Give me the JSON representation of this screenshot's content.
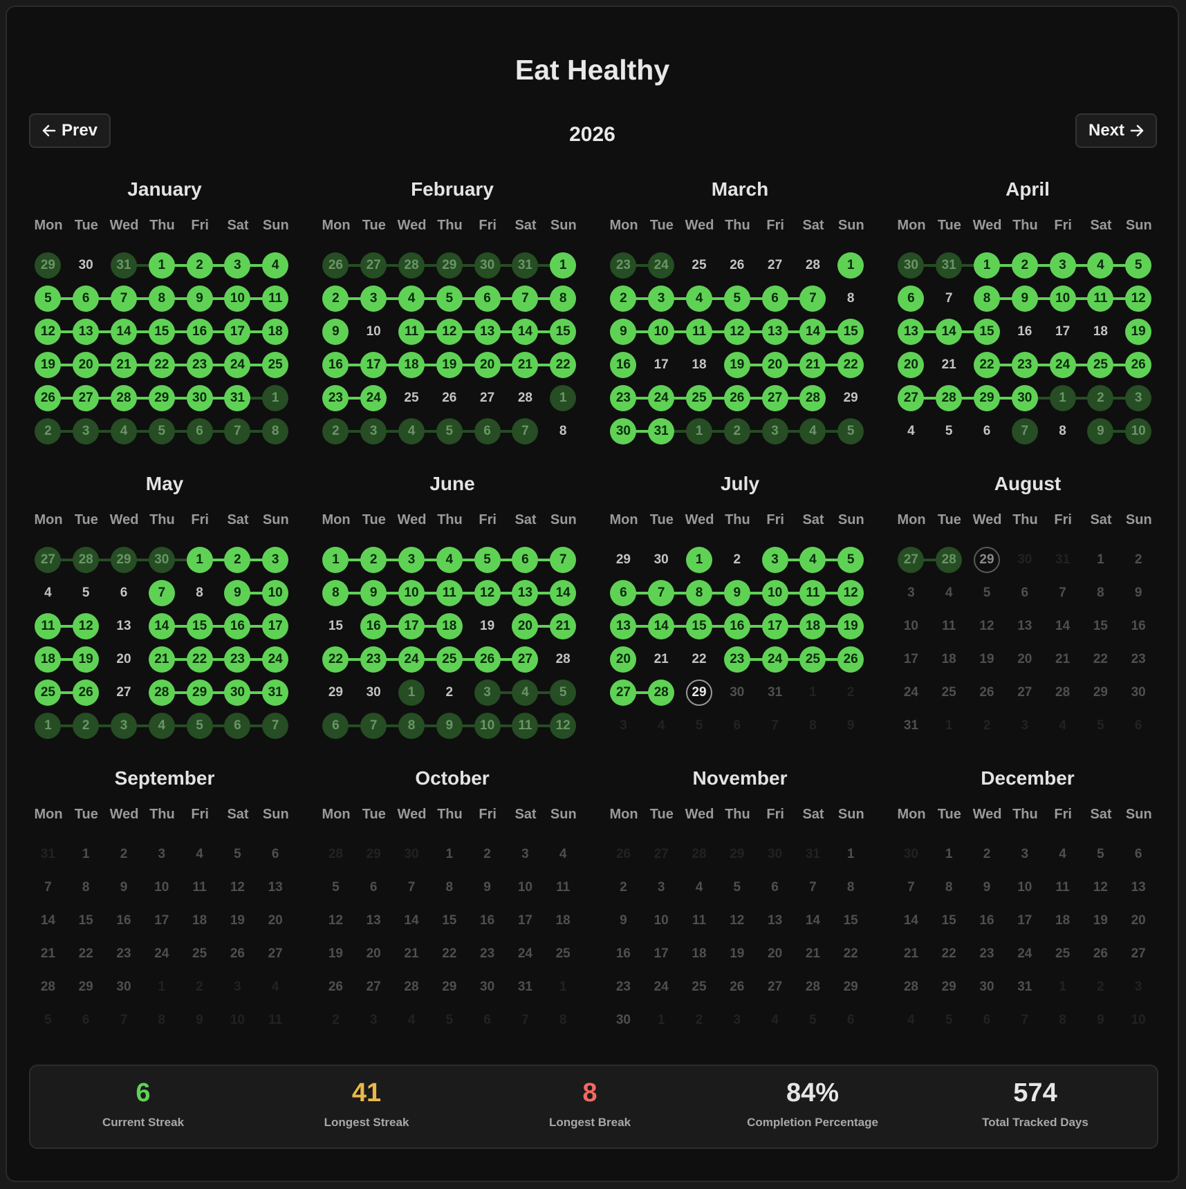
{
  "app_title": "Eat Healthy",
  "year": "2026",
  "nav": {
    "prev_label": "Prev",
    "next_label": "Next",
    "prev_icon": "arrow-left-icon",
    "next_icon": "arrow-right-icon"
  },
  "weekdays": [
    "Mon",
    "Tue",
    "Wed",
    "Thu",
    "Fri",
    "Sat",
    "Sun"
  ],
  "colors": {
    "done": "#5fd255",
    "done_faded": "#264d23",
    "current_streak": "#5fd255",
    "longest_streak": "#e8b84a",
    "longest_break": "#f06a63"
  },
  "months": [
    {
      "name": "January",
      "weeks": [
        [
          "29x",
          "30n",
          "31x",
          "1g",
          "2g",
          "3g",
          "4g"
        ],
        [
          "5g",
          "6g",
          "7g",
          "8g",
          "9g",
          "10g",
          "11g"
        ],
        [
          "12g",
          "13g",
          "14g",
          "15g",
          "16g",
          "17g",
          "18g"
        ],
        [
          "19g",
          "20g",
          "21g",
          "22g",
          "23g",
          "24g",
          "25g"
        ],
        [
          "26g",
          "27g",
          "28g",
          "29g",
          "30g",
          "31g",
          "1x"
        ],
        [
          "2x",
          "3x",
          "4x",
          "5x",
          "6x",
          "7x",
          "8x"
        ]
      ]
    },
    {
      "name": "February",
      "weeks": [
        [
          "26x",
          "27x",
          "28x",
          "29x",
          "30x",
          "31x",
          "1g"
        ],
        [
          "2g",
          "3g",
          "4g",
          "5g",
          "6g",
          "7g",
          "8g"
        ],
        [
          "9g",
          "10n",
          "11g",
          "12g",
          "13g",
          "14g",
          "15g"
        ],
        [
          "16g",
          "17g",
          "18g",
          "19g",
          "20g",
          "21g",
          "22g"
        ],
        [
          "23g",
          "24g",
          "25n",
          "26n",
          "27n",
          "28n",
          "1x"
        ],
        [
          "2x",
          "3x",
          "4x",
          "5x",
          "6x",
          "7x",
          "8n"
        ]
      ]
    },
    {
      "name": "March",
      "weeks": [
        [
          "23x",
          "24x",
          "25n",
          "26n",
          "27n",
          "28n",
          "1g"
        ],
        [
          "2g",
          "3g",
          "4g",
          "5g",
          "6g",
          "7g",
          "8n"
        ],
        [
          "9g",
          "10g",
          "11g",
          "12g",
          "13g",
          "14g",
          "15g"
        ],
        [
          "16g",
          "17n",
          "18n",
          "19g",
          "20g",
          "21g",
          "22g"
        ],
        [
          "23g",
          "24g",
          "25g",
          "26g",
          "27g",
          "28g",
          "29n"
        ],
        [
          "30g",
          "31g",
          "1x",
          "2x",
          "3x",
          "4x",
          "5x"
        ]
      ]
    },
    {
      "name": "April",
      "weeks": [
        [
          "30x",
          "31x",
          "1g",
          "2g",
          "3g",
          "4g",
          "5g"
        ],
        [
          "6g",
          "7n",
          "8g",
          "9g",
          "10g",
          "11g",
          "12g"
        ],
        [
          "13g",
          "14g",
          "15g",
          "16n",
          "17n",
          "18n",
          "19g"
        ],
        [
          "20g",
          "21n",
          "22g",
          "23g",
          "24g",
          "25g",
          "26g"
        ],
        [
          "27g",
          "28g",
          "29g",
          "30g",
          "1x",
          "2x",
          "3x"
        ],
        [
          "4n",
          "5n",
          "6n",
          "7x",
          "8n",
          "9x",
          "10x"
        ]
      ]
    },
    {
      "name": "May",
      "weeks": [
        [
          "27x",
          "28x",
          "29x",
          "30x",
          "1g",
          "2g",
          "3g"
        ],
        [
          "4n",
          "5n",
          "6n",
          "7g",
          "8n",
          "9g",
          "10g"
        ],
        [
          "11g",
          "12g",
          "13n",
          "14g",
          "15g",
          "16g",
          "17g"
        ],
        [
          "18g",
          "19g",
          "20n",
          "21g",
          "22g",
          "23g",
          "24g"
        ],
        [
          "25g",
          "26g",
          "27n",
          "28g",
          "29g",
          "30g",
          "31g"
        ],
        [
          "1x",
          "2x",
          "3x",
          "4x",
          "5x",
          "6x",
          "7x"
        ]
      ]
    },
    {
      "name": "June",
      "weeks": [
        [
          "1g",
          "2g",
          "3g",
          "4g",
          "5g",
          "6g",
          "7g"
        ],
        [
          "8g",
          "9g",
          "10g",
          "11g",
          "12g",
          "13g",
          "14g"
        ],
        [
          "15n",
          "16g",
          "17g",
          "18g",
          "19n",
          "20g",
          "21g"
        ],
        [
          "22g",
          "23g",
          "24g",
          "25g",
          "26g",
          "27g",
          "28n"
        ],
        [
          "29n",
          "30n",
          "1x",
          "2n",
          "3x",
          "4x",
          "5x"
        ],
        [
          "6x",
          "7x",
          "8x",
          "9x",
          "10x",
          "11x",
          "12x"
        ]
      ]
    },
    {
      "name": "July",
      "weeks": [
        [
          "29n",
          "30n",
          "1g",
          "2n",
          "3g",
          "4g",
          "5g"
        ],
        [
          "6g",
          "7g",
          "8g",
          "9g",
          "10g",
          "11g",
          "12g"
        ],
        [
          "13g",
          "14g",
          "15g",
          "16g",
          "17g",
          "18g",
          "19g"
        ],
        [
          "20g",
          "21n",
          "22n",
          "23g",
          "24g",
          "25g",
          "26g"
        ],
        [
          "27g",
          "28g",
          "29t",
          "30f",
          "31f",
          "1fx",
          "2fx"
        ],
        [
          "3fx",
          "4fx",
          "5fx",
          "6fx",
          "7fx",
          "8fx",
          "9fx"
        ]
      ]
    },
    {
      "name": "August",
      "weeks": [
        [
          "27x",
          "28x",
          "29t2",
          "30fx",
          "31fx",
          "1f",
          "2f"
        ],
        [
          "3f",
          "4f",
          "5f",
          "6f",
          "7f",
          "8f",
          "9f"
        ],
        [
          "10f",
          "11f",
          "12f",
          "13f",
          "14f",
          "15f",
          "16f"
        ],
        [
          "17f",
          "18f",
          "19f",
          "20f",
          "21f",
          "22f",
          "23f"
        ],
        [
          "24f",
          "25f",
          "26f",
          "27f",
          "28f",
          "29f",
          "30f"
        ],
        [
          "31f",
          "1fx",
          "2fx",
          "3fx",
          "4fx",
          "5fx",
          "6fx"
        ]
      ]
    },
    {
      "name": "September",
      "weeks": [
        [
          "31fx",
          "1f",
          "2f",
          "3f",
          "4f",
          "5f",
          "6f"
        ],
        [
          "7f",
          "8f",
          "9f",
          "10f",
          "11f",
          "12f",
          "13f"
        ],
        [
          "14f",
          "15f",
          "16f",
          "17f",
          "18f",
          "19f",
          "20f"
        ],
        [
          "21f",
          "22f",
          "23f",
          "24f",
          "25f",
          "26f",
          "27f"
        ],
        [
          "28f",
          "29f",
          "30f",
          "1fx",
          "2fx",
          "3fx",
          "4fx"
        ],
        [
          "5fx",
          "6fx",
          "7fx",
          "8fx",
          "9fx",
          "10fx",
          "11fx"
        ]
      ]
    },
    {
      "name": "October",
      "weeks": [
        [
          "28fx",
          "29fx",
          "30fx",
          "1f",
          "2f",
          "3f",
          "4f"
        ],
        [
          "5f",
          "6f",
          "7f",
          "8f",
          "9f",
          "10f",
          "11f"
        ],
        [
          "12f",
          "13f",
          "14f",
          "15f",
          "16f",
          "17f",
          "18f"
        ],
        [
          "19f",
          "20f",
          "21f",
          "22f",
          "23f",
          "24f",
          "25f"
        ],
        [
          "26f",
          "27f",
          "28f",
          "29f",
          "30f",
          "31f",
          "1fx"
        ],
        [
          "2fx",
          "3fx",
          "4fx",
          "5fx",
          "6fx",
          "7fx",
          "8fx"
        ]
      ]
    },
    {
      "name": "November",
      "weeks": [
        [
          "26fx",
          "27fx",
          "28fx",
          "29fx",
          "30fx",
          "31fx",
          "1f"
        ],
        [
          "2f",
          "3f",
          "4f",
          "5f",
          "6f",
          "7f",
          "8f"
        ],
        [
          "9f",
          "10f",
          "11f",
          "12f",
          "13f",
          "14f",
          "15f"
        ],
        [
          "16f",
          "17f",
          "18f",
          "19f",
          "20f",
          "21f",
          "22f"
        ],
        [
          "23f",
          "24f",
          "25f",
          "26f",
          "27f",
          "28f",
          "29f"
        ],
        [
          "30f",
          "1fx",
          "2fx",
          "3fx",
          "4fx",
          "5fx",
          "6fx"
        ]
      ]
    },
    {
      "name": "December",
      "weeks": [
        [
          "30fx",
          "1f",
          "2f",
          "3f",
          "4f",
          "5f",
          "6f"
        ],
        [
          "7f",
          "8f",
          "9f",
          "10f",
          "11f",
          "12f",
          "13f"
        ],
        [
          "14f",
          "15f",
          "16f",
          "17f",
          "18f",
          "19f",
          "20f"
        ],
        [
          "21f",
          "22f",
          "23f",
          "24f",
          "25f",
          "26f",
          "27f"
        ],
        [
          "28f",
          "29f",
          "30f",
          "31f",
          "1fx",
          "2fx",
          "3fx"
        ],
        [
          "4fx",
          "5fx",
          "6fx",
          "7fx",
          "8fx",
          "9fx",
          "10fx"
        ]
      ]
    }
  ],
  "stats": [
    {
      "value": "6",
      "label": "Current Streak",
      "color": "#5fd255"
    },
    {
      "value": "41",
      "label": "Longest Streak",
      "color": "#e8b84a"
    },
    {
      "value": "8",
      "label": "Longest Break",
      "color": "#f06a63"
    },
    {
      "value": "84%",
      "label": "Completion Percentage",
      "color": "#e6e6e6"
    },
    {
      "value": "574",
      "label": "Total Tracked Days",
      "color": "#e6e6e6"
    }
  ]
}
